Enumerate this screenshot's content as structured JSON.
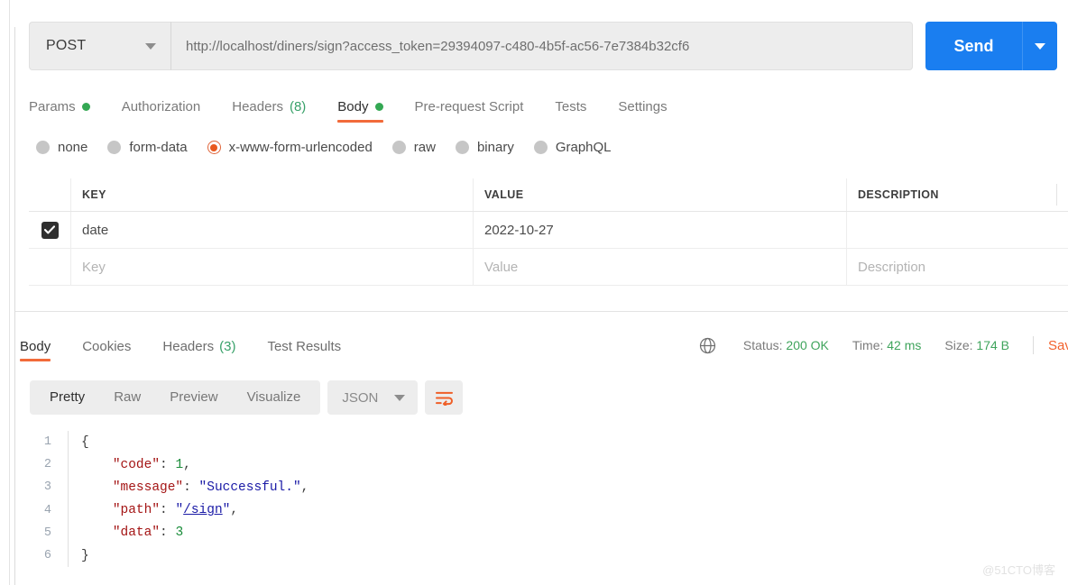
{
  "request": {
    "method": "POST",
    "url": "http://localhost/diners/sign?access_token=29394097-c480-4b5f-ac56-7e7384b32cf6",
    "send_label": "Send",
    "tabs": [
      {
        "label": "Params",
        "dot": true,
        "count": "",
        "active": false
      },
      {
        "label": "Authorization",
        "dot": false,
        "count": "",
        "active": false
      },
      {
        "label": "Headers",
        "dot": false,
        "count": "(8)",
        "active": false
      },
      {
        "label": "Body",
        "dot": true,
        "count": "",
        "active": true
      },
      {
        "label": "Pre-request Script",
        "dot": false,
        "count": "",
        "active": false
      },
      {
        "label": "Tests",
        "dot": false,
        "count": "",
        "active": false
      },
      {
        "label": "Settings",
        "dot": false,
        "count": "",
        "active": false
      }
    ],
    "body_types": [
      {
        "label": "none",
        "selected": false
      },
      {
        "label": "form-data",
        "selected": false
      },
      {
        "label": "x-www-form-urlencoded",
        "selected": true
      },
      {
        "label": "raw",
        "selected": false
      },
      {
        "label": "binary",
        "selected": false
      },
      {
        "label": "GraphQL",
        "selected": false
      }
    ],
    "table": {
      "headers": [
        "KEY",
        "VALUE",
        "DESCRIPTION"
      ],
      "rows": [
        {
          "checked": true,
          "key": "date",
          "value": "2022-10-27",
          "description": ""
        }
      ],
      "placeholder_row": {
        "key": "Key",
        "value": "Value",
        "description": "Description"
      }
    }
  },
  "response": {
    "tabs": [
      {
        "label": "Body",
        "count": "",
        "active": true
      },
      {
        "label": "Cookies",
        "count": "",
        "active": false
      },
      {
        "label": "Headers",
        "count": "(3)",
        "active": false
      },
      {
        "label": "Test Results",
        "count": "",
        "active": false
      }
    ],
    "meta": {
      "status_label": "Status:",
      "status_value": "200 OK",
      "time_label": "Time:",
      "time_value": "42 ms",
      "size_label": "Size:",
      "size_value": "174 B",
      "save_response": "Save Response"
    },
    "format_tabs": [
      {
        "label": "Pretty",
        "active": true
      },
      {
        "label": "Raw",
        "active": false
      },
      {
        "label": "Preview",
        "active": false
      },
      {
        "label": "Visualize",
        "active": false
      }
    ],
    "language": "JSON",
    "code_lines": [
      {
        "no": "1",
        "segments": [
          {
            "t": "{",
            "c": "k-pun"
          }
        ]
      },
      {
        "no": "2",
        "segments": [
          {
            "t": "    ",
            "c": "k-pun"
          },
          {
            "t": "\"code\"",
            "c": "k-key"
          },
          {
            "t": ": ",
            "c": "k-pun"
          },
          {
            "t": "1",
            "c": "k-num"
          },
          {
            "t": ",",
            "c": "k-pun"
          }
        ]
      },
      {
        "no": "3",
        "segments": [
          {
            "t": "    ",
            "c": "k-pun"
          },
          {
            "t": "\"message\"",
            "c": "k-key"
          },
          {
            "t": ": ",
            "c": "k-pun"
          },
          {
            "t": "\"Successful.\"",
            "c": "k-str"
          },
          {
            "t": ",",
            "c": "k-pun"
          }
        ]
      },
      {
        "no": "4",
        "segments": [
          {
            "t": "    ",
            "c": "k-pun"
          },
          {
            "t": "\"path\"",
            "c": "k-key"
          },
          {
            "t": ": ",
            "c": "k-pun"
          },
          {
            "t": "\"",
            "c": "k-str"
          },
          {
            "t": "/sign",
            "c": "k-link"
          },
          {
            "t": "\"",
            "c": "k-str"
          },
          {
            "t": ",",
            "c": "k-pun"
          }
        ]
      },
      {
        "no": "5",
        "segments": [
          {
            "t": "    ",
            "c": "k-pun"
          },
          {
            "t": "\"data\"",
            "c": "k-key"
          },
          {
            "t": ": ",
            "c": "k-pun"
          },
          {
            "t": "3",
            "c": "k-num"
          }
        ]
      },
      {
        "no": "6",
        "segments": [
          {
            "t": "}",
            "c": "k-pun"
          }
        ]
      }
    ]
  },
  "watermark": "@51CTO博客",
  "colors": {
    "accent_orange": "#f26b3a",
    "send_blue": "#1a7ef0",
    "status_green": "#3fa45c",
    "dot_green": "#34a853",
    "radio_selected": "#e8581e"
  }
}
